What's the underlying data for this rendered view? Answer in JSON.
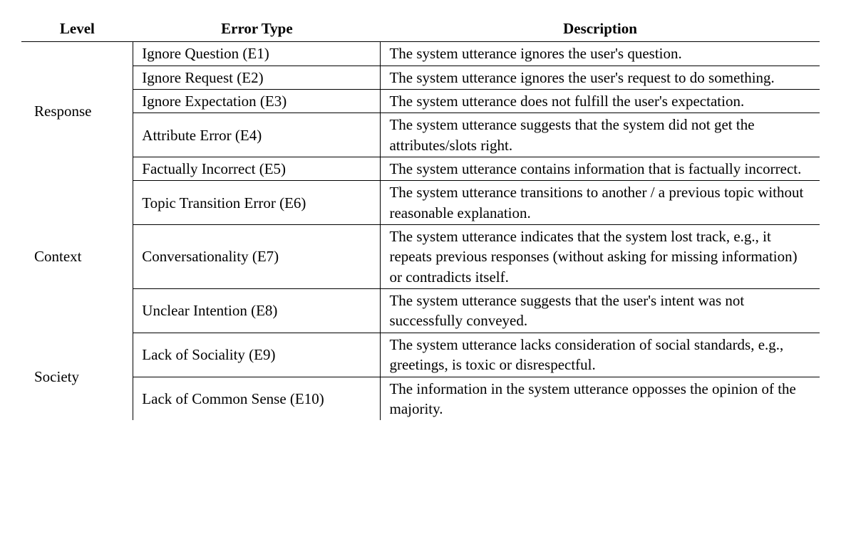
{
  "headers": {
    "level": "Level",
    "error": "Error Type",
    "desc": "Description"
  },
  "groups": [
    {
      "level": "Response",
      "rows": [
        {
          "error": "Ignore Question (E1)",
          "desc": "The system utterance ignores the user's question."
        },
        {
          "error": "Ignore Request (E2)",
          "desc": "The system utterance ignores the user's request to do something."
        },
        {
          "error": "Ignore Expectation (E3)",
          "desc": "The system utterance does not fulfill the user's expectation."
        },
        {
          "error": "Attribute Error (E4)",
          "desc": "The system utterance suggests that the system did not get the attributes/slots right."
        },
        {
          "error": "Factually Incorrect (E5)",
          "desc": "The system utterance contains information that is factually incorrect."
        }
      ]
    },
    {
      "level": "Context",
      "rows": [
        {
          "error": "Topic Transition Error (E6)",
          "desc": "The system utterance transitions to another / a previous topic without reasonable explanation."
        },
        {
          "error": "Conversationality (E7)",
          "desc": "The system utterance indicates that the system lost track, e.g., it repeats previous responses (without asking for missing information) or contradicts itself."
        },
        {
          "error": "Unclear Intention (E8)",
          "desc": "The system utterance suggests that the user's intent was not successfully conveyed."
        }
      ]
    },
    {
      "level": "Society",
      "rows": [
        {
          "error": "Lack of Sociality (E9)",
          "desc": "The system utterance lacks consideration of social standards, e.g., greetings, is toxic or disrespectful."
        },
        {
          "error": "Lack of Common Sense (E10)",
          "desc": "The information in the system utterance opposses the opinion of the majority."
        }
      ]
    }
  ]
}
